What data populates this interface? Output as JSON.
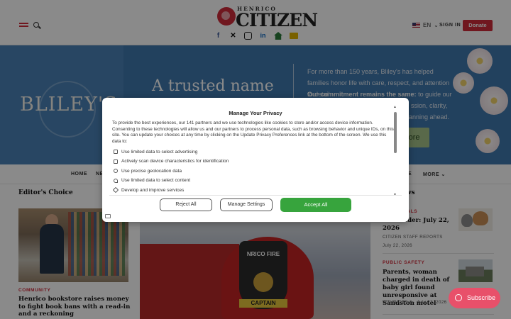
{
  "header": {
    "logo_small": "HENRICO",
    "logo_big": "CITIZEN",
    "lang": "EN",
    "signin": "SIGN IN",
    "donate": "Donate",
    "socials": [
      "facebook-icon",
      "x-icon",
      "instagram-icon",
      "linkedin-icon",
      "home-icon",
      "mail-icon"
    ]
  },
  "banner": {
    "brand": "BLILEY'S",
    "tagline": "A trusted name",
    "copy1": "For more than 150 years, Bliley's has helped families honor life with care, respect, and attention to detail.",
    "copy2_bold": "Our commitment remains the same:",
    "copy2": "to guide our",
    "copy3": "ssion, clarity,",
    "copy4": "planning ahead.",
    "cta": "more"
  },
  "nav": {
    "items": [
      "HOME",
      "NE",
      "E",
      "MORE"
    ]
  },
  "editors_choice": {
    "title": "Editor's Choice",
    "category": "COMMUNITY",
    "headline": "Henrico bookstore raises money to fight book bans with a read-in and a reckoning"
  },
  "news_sidebar": {
    "title": "ews",
    "items": [
      {
        "category": "IMALS",
        "headline": "our Finder: July 22, 2026",
        "source": "CITIZEN STAFF REPORTS",
        "date": "July 22, 2026"
      },
      {
        "category": "PUBLIC SAFETY",
        "headline": "Parents, woman charged in death of baby girl found unresponsive at Sandston motel",
        "source": "WTVR CBS 6 · July 22, 2026"
      }
    ]
  },
  "photo": {
    "helmet_text": "NRICO FIRE",
    "helmet_rank": "CAPTAIN"
  },
  "privacy_modal": {
    "title": "Manage Your Privacy",
    "body": "To provide the best experiences, our 141 partners and we use technologies like cookies to store and/or access device information. Consenting to these technologies will allow us and our partners to process personal data, such as browsing behavior and unique IDs, on this site. You can update your choices at any time by clicking on the Update Privacy Preferences link at the bottom of the screen. We use this data to:",
    "purposes": [
      "Use limited data to select advertising",
      "Actively scan device characteristics for identification",
      "Use precise geolocation data",
      "Use limited data to select content",
      "Develop and improve services"
    ],
    "reject_label": "Reject All",
    "manage_label": "Manage Settings",
    "accept_label": "Accept All"
  },
  "subscribe": {
    "label": "Subscribe"
  },
  "colors": {
    "brand_red": "#d02c3a",
    "accept_green": "#37a43d",
    "subscribe_pink": "#e8506a",
    "banner_blue": "#3f78ae"
  }
}
